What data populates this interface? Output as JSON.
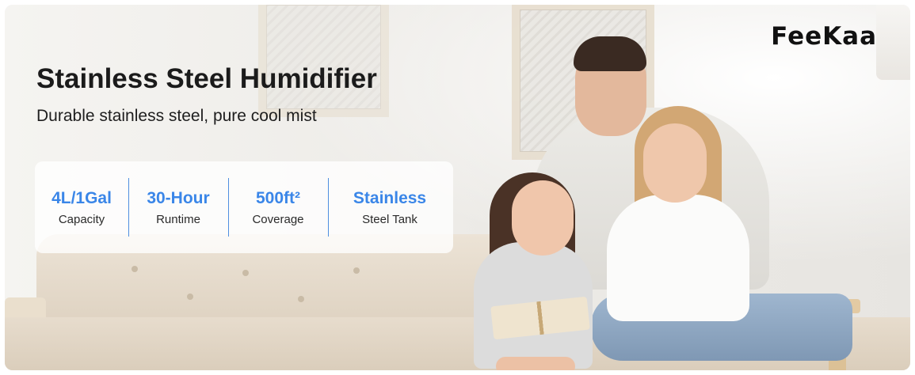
{
  "brand": {
    "logo_text": "FeeKaa"
  },
  "headline": {
    "title": "Stainless Steel Humidifier",
    "subtitle": "Durable stainless steel, pure cool mist"
  },
  "stats": [
    {
      "value": "4L/1Gal",
      "label": "Capacity"
    },
    {
      "value": "30-Hour",
      "label": "Runtime"
    },
    {
      "value": "500ft²",
      "label": "Coverage"
    },
    {
      "value": "Stainless",
      "label": "Steel Tank"
    }
  ],
  "colors": {
    "accent": "#3a86e8",
    "text": "#1b1b1b"
  }
}
